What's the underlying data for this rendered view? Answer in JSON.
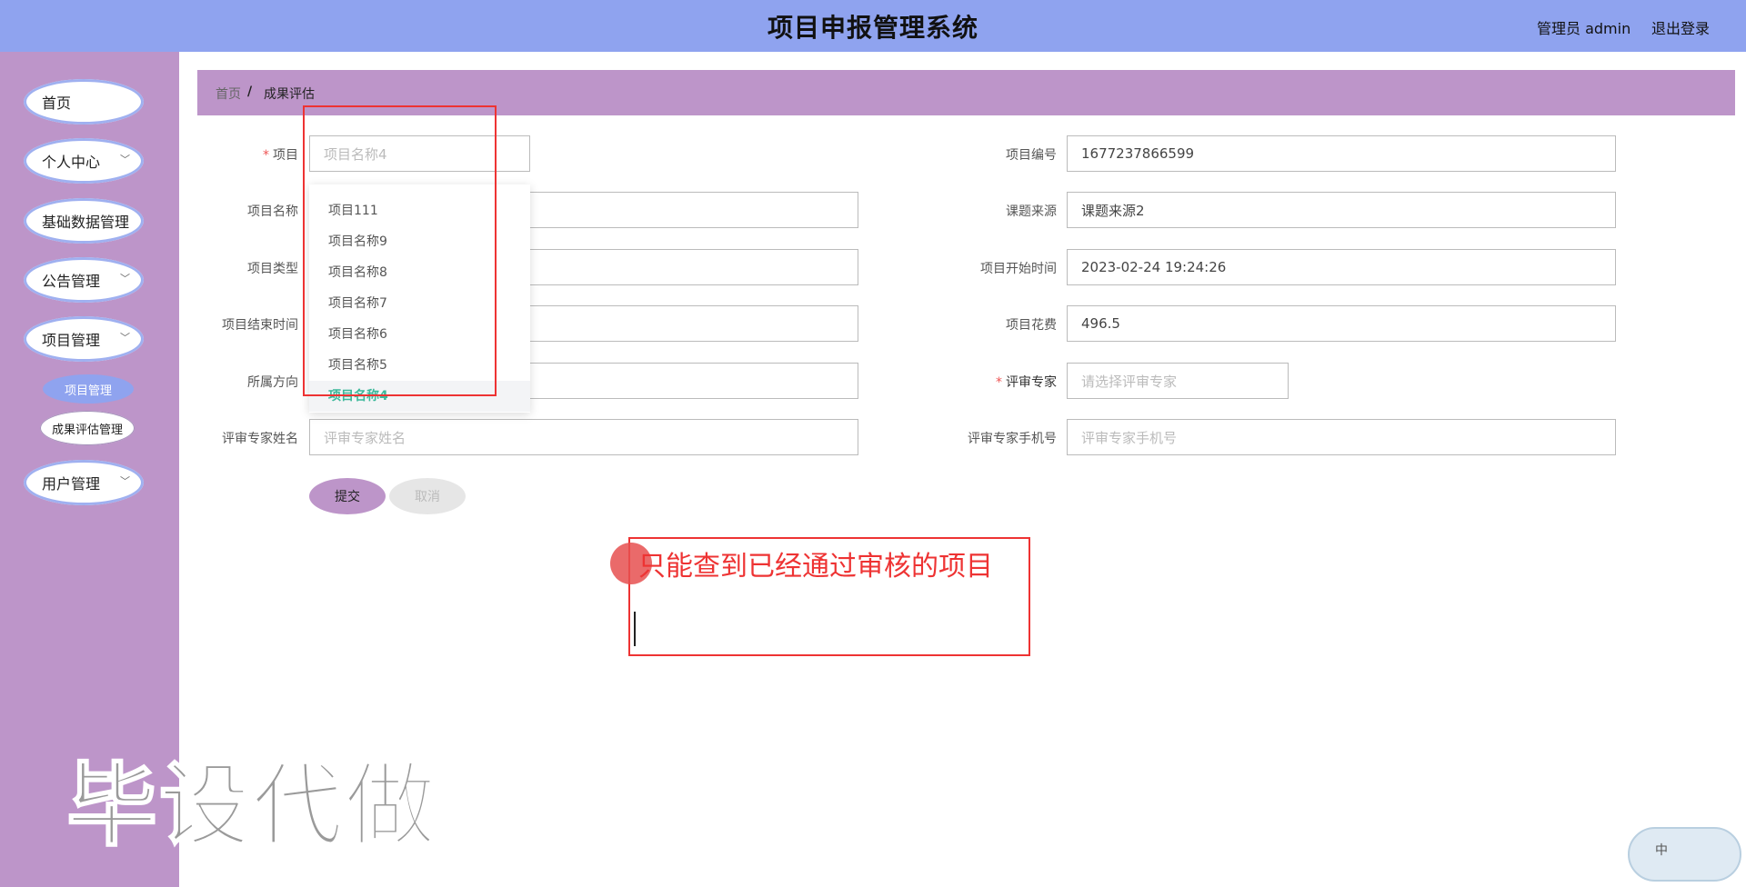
{
  "header": {
    "title": "项目申报管理系统",
    "user_label": "管理员 admin",
    "logout_label": "退出登录"
  },
  "sidebar": {
    "items": [
      {
        "label": "首页"
      },
      {
        "label": "个人中心"
      },
      {
        "label": "基础数据管理"
      },
      {
        "label": "公告管理"
      },
      {
        "label": "项目管理"
      },
      {
        "label": "用户管理"
      }
    ],
    "sub_items": [
      {
        "label": "项目管理"
      },
      {
        "label": "成果评估管理"
      }
    ],
    "chevron_glyph": "﹀"
  },
  "breadcrumb": {
    "home": "首页",
    "separator": "/",
    "current": "成果评估"
  },
  "form": {
    "required_mark": "*",
    "project_label": "项目",
    "project_placeholder": "项目名称4",
    "project_name_label": "项目名称",
    "project_type_label": "项目类型",
    "end_time_label": "项目结束时间",
    "direction_label": "所属方向",
    "expert_name_label": "评审专家姓名",
    "expert_name_placeholder": "评审专家姓名",
    "project_no_label": "项目编号",
    "project_no_value": "1677237866599",
    "topic_source_label": "课题来源",
    "topic_source_value": "课题来源2",
    "start_time_label": "项目开始时间",
    "start_time_value": "2023-02-24 19:24:26",
    "cost_label": "项目花费",
    "cost_value": "496.5",
    "expert_label": "评审专家",
    "expert_placeholder": "请选择评审专家",
    "expert_phone_label": "评审专家手机号",
    "expert_phone_placeholder": "评审专家手机号",
    "submit_label": "提交",
    "cancel_label": "取消"
  },
  "dropdown": {
    "options": [
      "项目111",
      "项目名称9",
      "项目名称8",
      "项目名称7",
      "项目名称6",
      "项目名称5",
      "项目名称4"
    ],
    "selected": "项目名称4"
  },
  "annotation": {
    "text": "只能查到已经通过审核的项目"
  },
  "watermark": "毕设代做",
  "ime": {
    "label": "中"
  },
  "colors": {
    "header_bg": "#8fa3ef",
    "sidebar_bg": "#bd95c9",
    "accent_red": "#e33333",
    "selected_option": "#3cb89a"
  }
}
